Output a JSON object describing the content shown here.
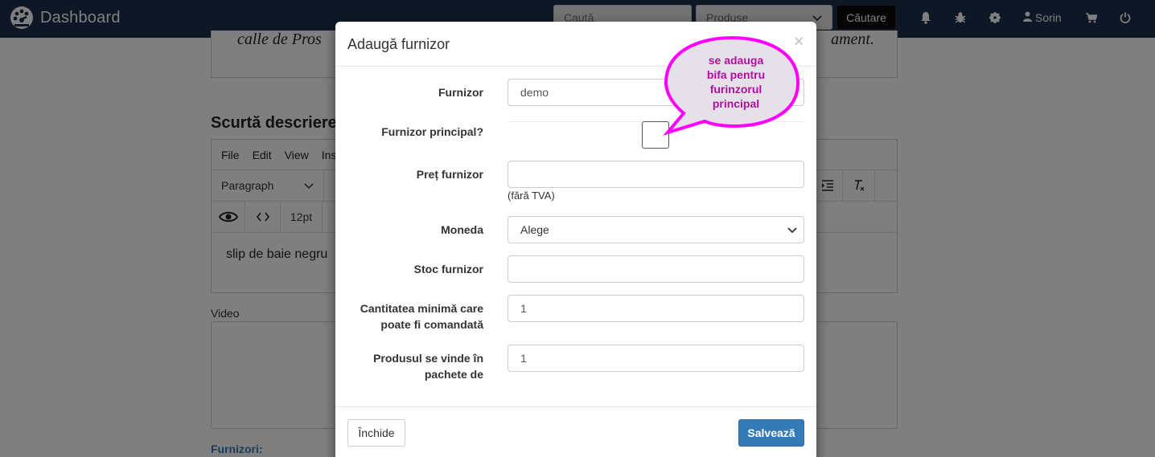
{
  "navbar": {
    "brand": "Dashboard",
    "search_placeholder": "Caută",
    "category_selected": "Produse",
    "search_button": "Căutare",
    "user": "Sorin"
  },
  "background": {
    "quote_left": "calle de Pros",
    "quote_right": "ament.",
    "section_title": "Scurtă descriere",
    "editor_menu": [
      "File",
      "Edit",
      "View",
      "Ins"
    ],
    "paragraph_format": "Paragraph",
    "font_size": "12pt",
    "editor_content": "slip de baie negru",
    "video_label": "Video",
    "furnizori_label": "Furnizori:"
  },
  "modal": {
    "title": "Adaugă furnizor",
    "close_symbol": "×",
    "fields": {
      "furnizor_label": "Furnizor",
      "furnizor_value": "demo",
      "principal_label": "Furnizor principal?",
      "pret_label": "Preț furnizor",
      "pret_value": "",
      "pret_help": "(fără TVA)",
      "moneda_label": "Moneda",
      "moneda_value": "Alege",
      "stoc_label": "Stoc furnizor",
      "stoc_value": "",
      "cantitate_label_1": "Cantitatea minimă care",
      "cantitate_label_2": "poate fi comandată",
      "cantitate_value": "1",
      "pachete_label_1": "Produsul se vinde în",
      "pachete_label_2": "pachete de",
      "pachete_value": "1"
    },
    "footer": {
      "close_button": "Închide",
      "save_button": "Salvează"
    }
  },
  "annotation": {
    "lines": [
      "se adauga",
      "bifa pentru",
      "furinzorul",
      "principal"
    ],
    "color": "#ff00ff"
  }
}
